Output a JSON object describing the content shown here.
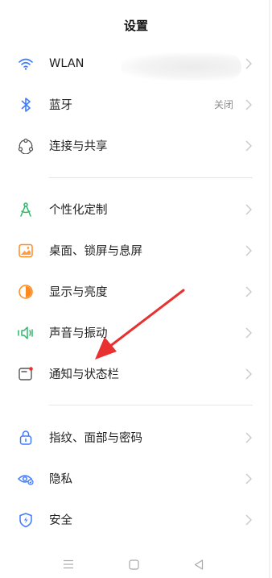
{
  "header": {
    "title": "设置"
  },
  "groups": [
    [
      {
        "id": "wlan",
        "label": "WLAN",
        "icon": "wifi-icon",
        "value": ""
      },
      {
        "id": "bluetooth",
        "label": "蓝牙",
        "icon": "bluetooth-icon",
        "value": "关闭"
      },
      {
        "id": "share",
        "label": "连接与共享",
        "icon": "share-connection-icon",
        "value": ""
      }
    ],
    [
      {
        "id": "personalization",
        "label": "个性化定制",
        "icon": "personalization-icon",
        "value": ""
      },
      {
        "id": "wallpaper",
        "label": "桌面、锁屏与息屏",
        "icon": "wallpaper-icon",
        "value": ""
      },
      {
        "id": "display",
        "label": "显示与亮度",
        "icon": "brightness-icon",
        "value": ""
      },
      {
        "id": "sound",
        "label": "声音与振动",
        "icon": "sound-vibration-icon",
        "value": ""
      },
      {
        "id": "notifications",
        "label": "通知与状态栏",
        "icon": "notification-bar-icon",
        "value": ""
      }
    ],
    [
      {
        "id": "security-unlock",
        "label": "指纹、面部与密码",
        "icon": "lock-icon",
        "value": ""
      },
      {
        "id": "privacy",
        "label": "隐私",
        "icon": "privacy-eye-icon",
        "value": ""
      },
      {
        "id": "security",
        "label": "安全",
        "icon": "security-shield-icon",
        "value": ""
      }
    ]
  ],
  "navbar": [
    "menu-icon",
    "home-icon",
    "back-icon"
  ],
  "colors": {
    "accent_blue": "#3f7bff",
    "accent_green": "#2fb86a",
    "accent_orange": "#ff8a1f",
    "annotation_red": "#e8322f"
  }
}
